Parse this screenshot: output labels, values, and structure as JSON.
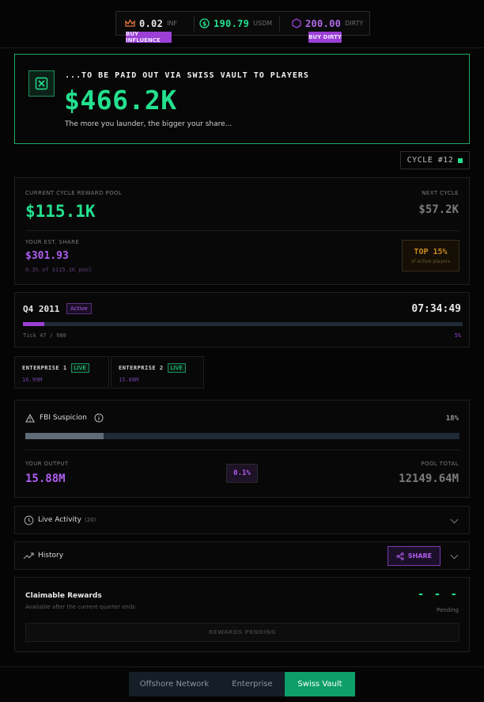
{
  "topbar": {
    "influence": {
      "value": "0.02",
      "unit": "INF",
      "button": "BUY INFLUENCE",
      "icon": "crown-icon"
    },
    "usdm": {
      "value": "190.79",
      "unit": "USDM",
      "icon": "dollar-coin-icon"
    },
    "dirty": {
      "value": "200.00",
      "unit": "DIRTY",
      "button": "BUY DIRTY",
      "icon": "hexagon-icon"
    }
  },
  "hero": {
    "subtitle": "...TO BE PAID OUT VIA SWISS VAULT TO PLAYERS",
    "amount": "$466.2K",
    "tagline": "The more you launder, the bigger your share..."
  },
  "cycle": {
    "label": "CYCLE #12"
  },
  "pool": {
    "current_label": "CURRENT CYCLE REWARD POOL",
    "current_value": "$115.1K",
    "next_label": "NEXT CYCLE",
    "next_value": "$57.2K",
    "share_label": "YOUR EST. SHARE",
    "share_value": "$301.93",
    "share_detail": "0.3% of $115.1K pool",
    "rank_value": "TOP 15%",
    "rank_label": "of active players"
  },
  "quarter": {
    "name": "Q4 2011",
    "status": "Active",
    "timer": "07:34:49",
    "tick": "Tick 47 / 980",
    "percent_label": "5%",
    "progress": 0.048
  },
  "enterprises": [
    {
      "name": "ENTERPRISE 1",
      "badge": "LIVE",
      "value": "16.99M"
    },
    {
      "name": "ENTERPRISE 2",
      "badge": "LIVE",
      "value": "15.88M"
    }
  ],
  "fbi": {
    "title": "FBI Suspicion",
    "percent_label": "18%",
    "level": 0.18,
    "output_label": "YOUR OUTPUT",
    "output_value": "15.88M",
    "ratio": "0.1%",
    "pool_label": "POOL TOTAL",
    "pool_value": "12149.64M"
  },
  "activity": {
    "title": "Live Activity",
    "count": "(20)"
  },
  "history": {
    "title": "History",
    "share_button": "SHARE"
  },
  "claim": {
    "title": "Claimable Rewards",
    "subtitle": "Available after the current quarter ends",
    "dashes": "- - -",
    "status": "Pending",
    "button": "REWARDS PENDING"
  },
  "tabs": [
    {
      "label": "Offshore Network"
    },
    {
      "label": "Enterprise"
    },
    {
      "label": "Swiss Vault"
    }
  ],
  "colors": {
    "accent_green": "#23e08e",
    "accent_purple": "#9b3fd6",
    "background": "#050505"
  }
}
